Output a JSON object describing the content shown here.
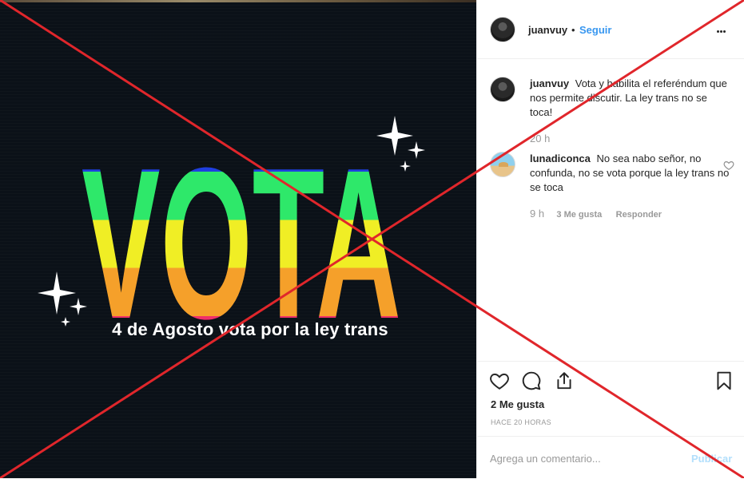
{
  "image": {
    "word": "VOTA",
    "caption": "4 de Agosto vota por la ley trans",
    "rainbow_colors": [
      "#1f3fe0",
      "#2ee86a",
      "#f0ee25",
      "#f5a02a",
      "#f0306a"
    ],
    "background_color": "#0b1118",
    "overlay_color": "#e0262b"
  },
  "header": {
    "username": "juanvuy",
    "separator": "•",
    "follow_label": "Seguir",
    "more_icon": "more-options-icon"
  },
  "comments": [
    {
      "username": "juanvuy",
      "text": "Vota y habilita el referéndum que nos permite discutir. La ley trans no se toca!",
      "time": "20 h"
    },
    {
      "username": "lunadiconca",
      "text": "No sea nabo señor, no confunda, no se vota porque la ley trans no se toca",
      "time": "9 h",
      "likes_label": "3 Me gusta",
      "reply_label": "Responder"
    }
  ],
  "actions": {
    "like_icon": "heart-icon",
    "comment_icon": "comment-icon",
    "share_icon": "share-icon",
    "save_icon": "bookmark-icon"
  },
  "likes": "2 Me gusta",
  "post_time": "HACE 20 HORAS",
  "comment_form": {
    "placeholder": "Agrega un comentario...",
    "publish_label": "Publicar"
  }
}
